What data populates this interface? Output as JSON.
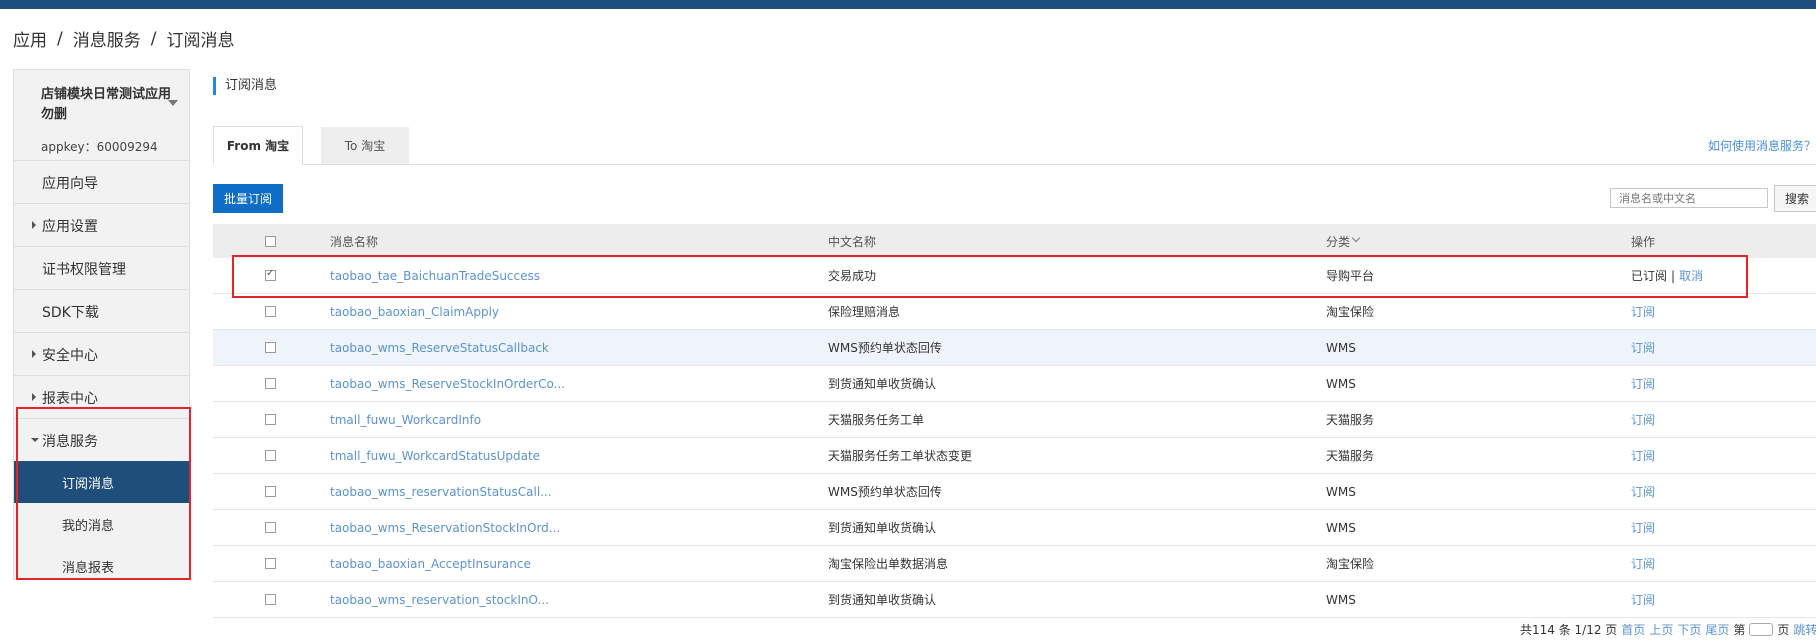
{
  "breadcrumb": {
    "items": [
      "应用",
      "消息服务",
      "订阅消息"
    ],
    "separator": "/"
  },
  "sidebar": {
    "app_name": "店铺模块日常测试应用勿删",
    "appkey": "appkey：60009294",
    "items": [
      {
        "label": "应用向导",
        "arrow": "none"
      },
      {
        "label": "应用设置",
        "arrow": "right"
      },
      {
        "label": "证书权限管理",
        "arrow": "none"
      },
      {
        "label": "SDK下载",
        "arrow": "none"
      },
      {
        "label": "安全中心",
        "arrow": "right"
      },
      {
        "label": "报表中心",
        "arrow": "right"
      },
      {
        "label": "消息服务",
        "arrow": "down"
      }
    ],
    "subitems": [
      {
        "label": "订阅消息",
        "active": true
      },
      {
        "label": "我的消息",
        "active": false
      },
      {
        "label": "消息报表",
        "active": false
      }
    ]
  },
  "main": {
    "section_title": "订阅消息",
    "tabs": [
      {
        "label": "From 淘宝",
        "active": true
      },
      {
        "label": "To 淘宝",
        "active": false
      }
    ],
    "help_link": "如何使用消息服务？",
    "batch_button": "批量订阅",
    "search": {
      "placeholder": "消息名或中文名",
      "button": "搜索"
    },
    "table": {
      "headers": {
        "name": "消息名称",
        "cn": "中文名称",
        "category": "分类",
        "op": "操作"
      },
      "rows": [
        {
          "name": "taobao_tae_BaichuanTradeSuccess",
          "cn": "交易成功",
          "category": "导购平台",
          "subscribed": true,
          "op_status": "已订阅",
          "op_sep": "|",
          "op_action": "取消"
        },
        {
          "name": "taobao_baoxian_ClaimApply",
          "cn": "保险理赔消息",
          "category": "淘宝保险",
          "op_action": "订阅"
        },
        {
          "name": "taobao_wms_ReserveStatusCallback",
          "cn": "WMS预约单状态回传",
          "category": "WMS",
          "op_action": "订阅"
        },
        {
          "name": "taobao_wms_ReserveStockInOrderCo...",
          "cn": "到货通知单收货确认",
          "category": "WMS",
          "op_action": "订阅"
        },
        {
          "name": "tmall_fuwu_WorkcardInfo",
          "cn": "天猫服务任务工单",
          "category": "天猫服务",
          "op_action": "订阅"
        },
        {
          "name": "tmall_fuwu_WorkcardStatusUpdate",
          "cn": "天猫服务任务工单状态变更",
          "category": "天猫服务",
          "op_action": "订阅"
        },
        {
          "name": "taobao_wms_reservationStatusCall...",
          "cn": "WMS预约单状态回传",
          "category": "WMS",
          "op_action": "订阅"
        },
        {
          "name": "taobao_wms_ReservationStockInOrd...",
          "cn": "到货通知单收货确认",
          "category": "WMS",
          "op_action": "订阅"
        },
        {
          "name": "taobao_baoxian_AcceptInsurance",
          "cn": "淘宝保险出单数据消息",
          "category": "淘宝保险",
          "op_action": "订阅"
        },
        {
          "name": "taobao_wms_reservation_stockInO...",
          "cn": "到货通知单收货确认",
          "category": "WMS",
          "op_action": "订阅"
        }
      ]
    },
    "pager": {
      "summary": "共114 条 1/12 页",
      "first": "首页",
      "prev": "上页",
      "next": "下页",
      "last": "尾页",
      "goto_prefix": "第",
      "goto_suffix": "页",
      "jump": "跳转"
    }
  },
  "colors": {
    "topbar": "#1d4f7e",
    "active_nav": "#1e4e79",
    "primary_button": "#0e6dc6",
    "link": "#5b93cf",
    "highlight_box": "#e0262a"
  }
}
